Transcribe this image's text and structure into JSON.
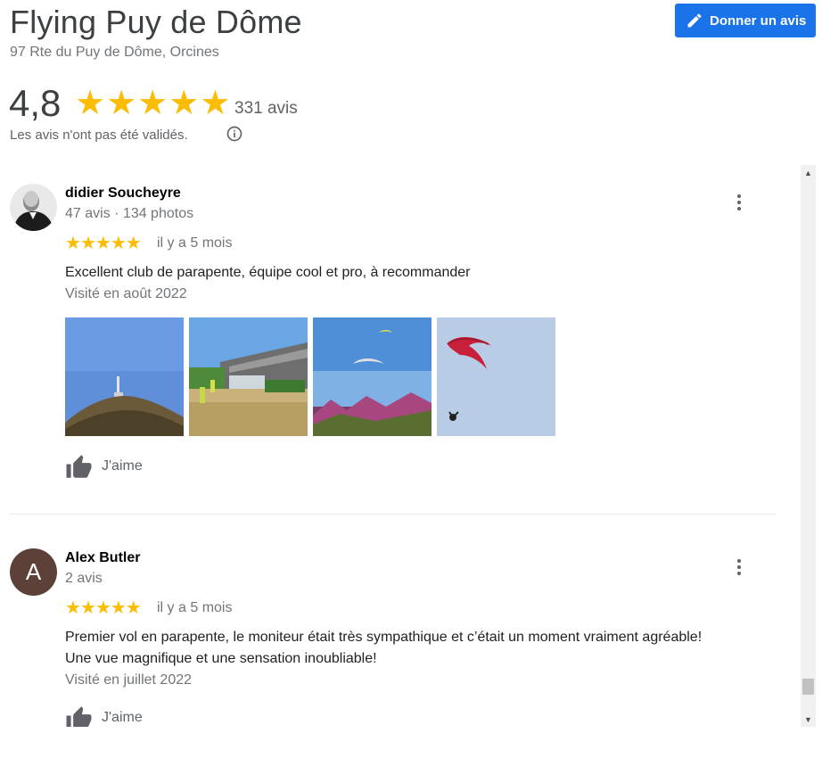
{
  "place": {
    "title": "Flying Puy de Dôme",
    "address": "97 Rte du Puy de Dôme, Orcines"
  },
  "write_review": {
    "label": "Donner un avis",
    "icon": "pencil-icon"
  },
  "summary": {
    "rating": "4,8",
    "stars": 5,
    "count": "331 avis",
    "unverified_notice": "Les avis n'ont pas été validés.",
    "info_icon": "info-icon"
  },
  "reviews": [
    {
      "name": "didier Soucheyre",
      "meta": "47 avis · 134 photos",
      "stars": 5,
      "date": "il y a 5 mois",
      "text": "Excellent club de parapente, équipe cool et pro, à recommander",
      "visited": "Visité en août 2022",
      "photo_count": 4,
      "like_label": "J'aime"
    },
    {
      "name": "Alex Butler",
      "avatar_letter": "A",
      "meta": "2 avis",
      "stars": 5,
      "date": "il y a 5 mois",
      "text_line1": "Premier vol en parapente, le moniteur était très sympathique et c’était un moment vraiment agréable!",
      "text_line2": "Une vue magnifique et une sensation inoubliable!",
      "visited": "Visité en juillet 2022",
      "like_label": "J'aime"
    }
  ],
  "colors": {
    "accent": "#1a73e8",
    "star": "#fbbc04",
    "muted_text": "#70757a"
  }
}
